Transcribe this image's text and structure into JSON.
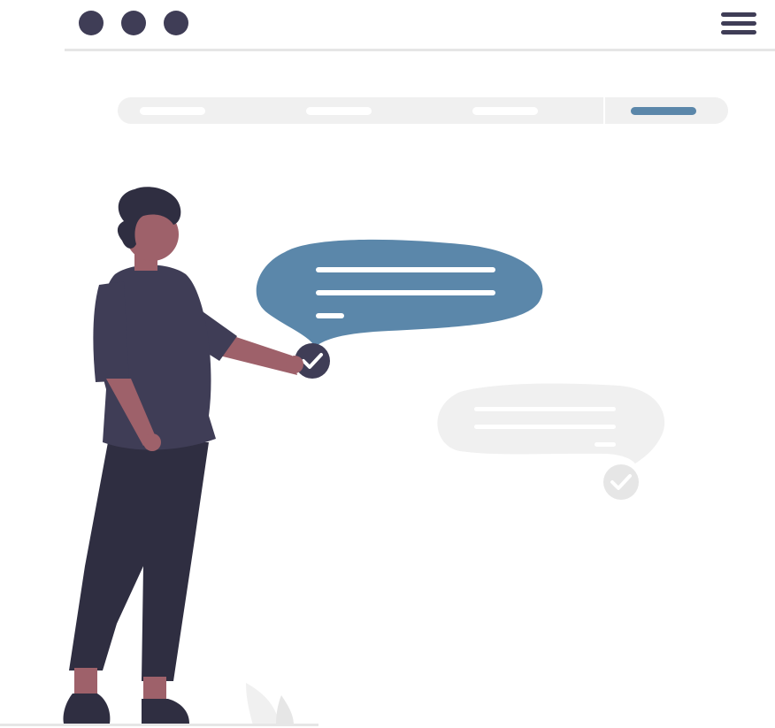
{
  "colors": {
    "dark": "#3f3d56",
    "accent": "#5b87aa",
    "light_gray": "#f0f0f0",
    "divider": "#e6e6e6",
    "skin": "#9e616a",
    "hair": "#2f2e41",
    "pants": "#2f2e41",
    "white": "#ffffff"
  },
  "window_controls": [
    "window-dot-1",
    "window-dot-2",
    "window-dot-3"
  ],
  "header": {
    "menu_icon": "hamburger-menu-icon"
  },
  "nav_tabs": [
    {
      "name": "nav-tab-1",
      "active": false
    },
    {
      "name": "nav-tab-2",
      "active": false
    },
    {
      "name": "nav-tab-3",
      "active": false
    },
    {
      "name": "nav-tab-4",
      "active": true
    }
  ],
  "messages": [
    {
      "name": "active-message-bubble",
      "state": "sent",
      "icon": "check-icon"
    },
    {
      "name": "faded-message-bubble",
      "state": "pending",
      "icon": "check-icon"
    }
  ]
}
